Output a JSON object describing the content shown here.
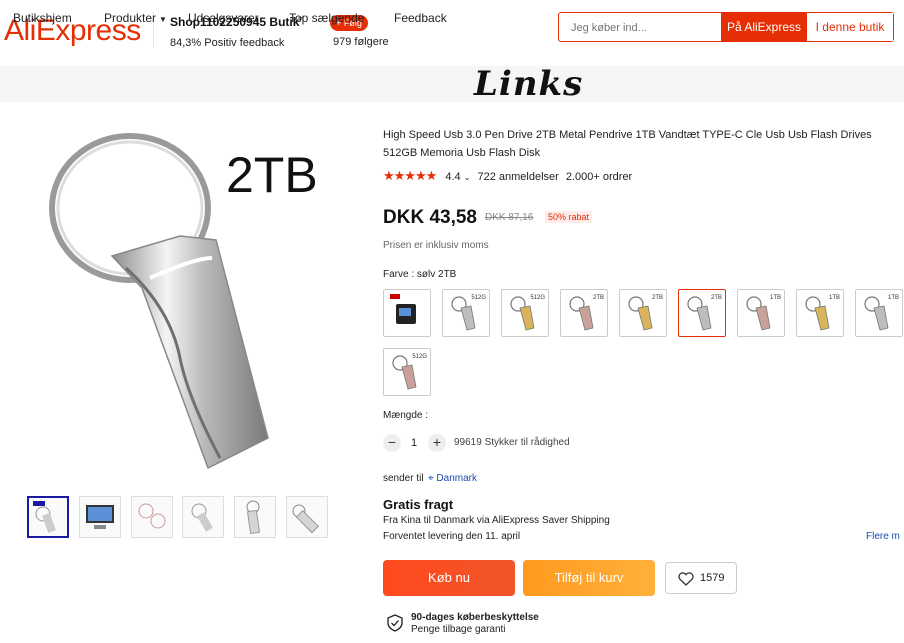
{
  "header": {
    "logo": "AliExpress",
    "shop_name": "Shop1102250945 Butik",
    "feedback": "84,3% Positiv feedback",
    "follow_label": "+ Følg",
    "followers": "979 følgere",
    "search_placeholder": "Jeg køber ind...",
    "search_ali_label": "På AliExpress",
    "search_store_label": "I denne butik"
  },
  "nav": {
    "items": [
      "Butikshjem",
      "Produkter",
      "Udsalgsvarer",
      "Top sælgende",
      "Feedback"
    ],
    "overlay_title": "Links"
  },
  "gallery": {
    "image_label": "2TB",
    "thumbnail_count": 6
  },
  "product": {
    "title": "High Speed Usb 3.0 Pen Drive 2TB Metal Pendrive 1TB Vandtæt TYPE-C Cle Usb Usb Flash Drives 512GB Memoria Usb Flash Disk",
    "rating": "4.4",
    "reviews": "722 anmeldelser",
    "orders": "2.000+ ordrer",
    "price": "DKK 43,58",
    "old_price": "DKK 87,16",
    "discount": "50% rabat",
    "vat_note": "Prisen er inklusiv moms",
    "color_label": "Farve : sølv 2TB",
    "swatches": [
      {
        "cap": "",
        "color": "#c9c9c9"
      },
      {
        "cap": "512G",
        "color": "#bdbdbd"
      },
      {
        "cap": "512G",
        "color": "#d8b55a"
      },
      {
        "cap": "2TB",
        "color": "#c9a19a"
      },
      {
        "cap": "2TB",
        "color": "#d8b55a"
      },
      {
        "cap": "2TB",
        "color": "#bdbdbd"
      },
      {
        "cap": "1TB",
        "color": "#c9a19a"
      },
      {
        "cap": "1TB",
        "color": "#d8b55a"
      },
      {
        "cap": "1TB",
        "color": "#bdbdbd"
      },
      {
        "cap": "512G",
        "color": "#c9a19a"
      }
    ],
    "selected_swatch": 5,
    "quantity_label": "Mængde :",
    "quantity_minus": "−",
    "quantity": "1",
    "quantity_plus": "+",
    "availability": "99619 Stykker til rådighed",
    "ship_to_label": "sender til",
    "ship_to_country": "Danmark",
    "free_shipping": "Gratis fragt",
    "ship_via": "Fra Kina til Danmark via AliExpress Saver Shipping",
    "delivery": "Forventet levering den 11. april",
    "more_link": "Flere m",
    "buy_now": "Køb nu",
    "add_to_cart": "Tilføj til kurv",
    "wishlist_count": "1579",
    "protection_title": "90-dages køberbeskyttelse",
    "protection_sub": "Penge tilbage garanti"
  },
  "colors": {
    "brand": "#e62e04",
    "link": "#1a4ab0"
  }
}
